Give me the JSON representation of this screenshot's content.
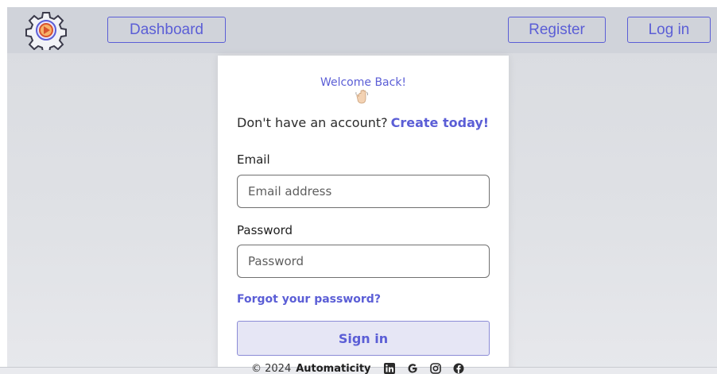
{
  "nav": {
    "logo_icon": "gear-play-icon",
    "dashboard_label": "Dashboard",
    "register_label": "Register",
    "login_label": "Log in"
  },
  "card": {
    "welcome": "Welcome Back!",
    "wave_icon": "waving-hand-icon",
    "no_account_text": "Don't have an account?",
    "create_link": "Create today!",
    "email_label": "Email",
    "email_placeholder": "Email address",
    "password_label": "Password",
    "password_placeholder": "Password",
    "forgot_link": "Forgot your password?",
    "signin_label": "Sign in"
  },
  "footer": {
    "copyright": "© 2024",
    "brand": "Automaticity",
    "social_icons": [
      "linkedin-icon",
      "google-icon",
      "instagram-icon",
      "facebook-icon"
    ]
  },
  "colors": {
    "accent": "#5b5ed6",
    "navbar_bg": "#d0d3da",
    "page_bg": "#dfe1e5",
    "signin_bg": "#e6e6f5"
  }
}
